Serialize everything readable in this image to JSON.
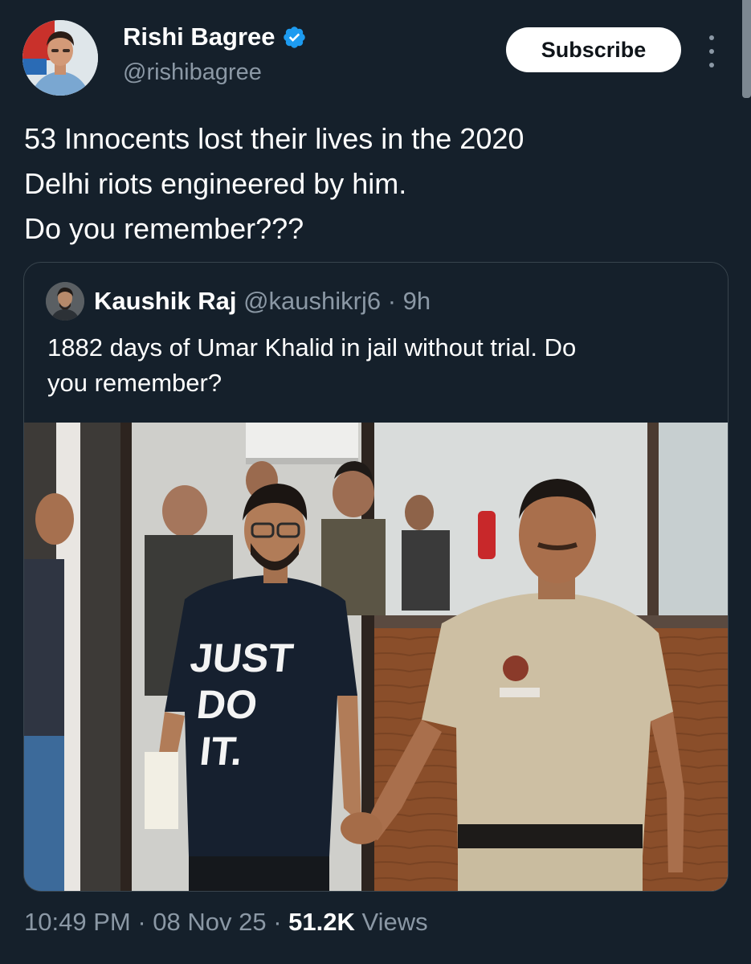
{
  "author": {
    "name": "Rishi Bagree",
    "handle": "@rishibagree",
    "verified_color": "#1d9bf0"
  },
  "actions": {
    "subscribe_label": "Subscribe",
    "more_icon": "more-vertical-icon"
  },
  "tweet": {
    "lines": [
      "53 Innocents lost their lives in the 2020",
      "Delhi riots engineered by him.",
      "Do you remember???"
    ]
  },
  "quote": {
    "name": "Kaushik Raj",
    "handle": "@kaushikrj6",
    "separator": " · ",
    "time": "9h",
    "lines": [
      "1882 days of Umar Khalid in jail without trial. Do",
      "you remember?"
    ],
    "photo_shirt_text": [
      "JUST",
      "DO",
      "IT."
    ]
  },
  "footer": {
    "time": "10:49 PM",
    "sep1": " · ",
    "date": "08 Nov 25",
    "sep2": " · ",
    "views_count": "51.2K",
    "views_label": " Views"
  },
  "colors": {
    "background": "#15202b",
    "text": "#ffffff",
    "muted": "#8b98a5",
    "border": "#38444d"
  }
}
